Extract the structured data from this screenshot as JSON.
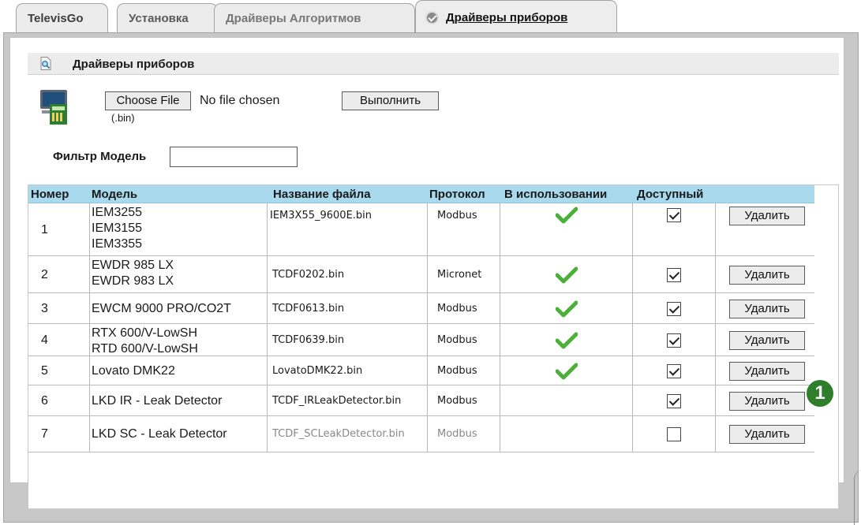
{
  "tabs": [
    {
      "label": "TelevisGo"
    },
    {
      "label": "Установка"
    },
    {
      "label": "Драйверы Алгоритмов"
    },
    {
      "label": "Драйверы приборов",
      "active": true
    }
  ],
  "section": {
    "title": "Драйверы приборов",
    "icon": "document-search-icon"
  },
  "upload": {
    "choose_file_label": "Choose File",
    "no_file_text": "No file chosen",
    "extension_note": "(.bin)",
    "execute_label": "Выполнить"
  },
  "filter": {
    "label": "Фильтр Модель",
    "value": ""
  },
  "table": {
    "headers": {
      "number": "Номер",
      "model": "Модель",
      "filename": "Название файла",
      "protocol": "Протокол",
      "in_use": "В использовании",
      "available": "Доступный"
    },
    "rows": [
      {
        "number": "1",
        "model": [
          "IEM3255",
          "IEM3155",
          "IEM3355"
        ],
        "filename": "IEM3X55_9600E.bin",
        "protocol": "Modbus",
        "in_use": true,
        "available": true,
        "delete_label": "Удалить"
      },
      {
        "number": "2",
        "model": [
          "EWDR 985 LX",
          "EWDR 983 LX"
        ],
        "filename": "TCDF0202.bin",
        "protocol": "Micronet",
        "in_use": true,
        "available": true,
        "delete_label": "Удалить"
      },
      {
        "number": "3",
        "model": [
          "EWCM 9000 PRO/CO2T"
        ],
        "filename": "TCDF0613.bin",
        "protocol": "Modbus",
        "in_use": true,
        "available": true,
        "delete_label": "Удалить"
      },
      {
        "number": "4",
        "model": [
          "RTX 600/V-LowSH",
          "RTD 600/V-LowSH"
        ],
        "filename": "TCDF0639.bin",
        "protocol": "Modbus",
        "in_use": true,
        "available": true,
        "delete_label": "Удалить"
      },
      {
        "number": "5",
        "model": [
          "Lovato DMK22"
        ],
        "filename": "LovatoDMK22.bin",
        "protocol": "Modbus",
        "in_use": true,
        "available": true,
        "delete_label": "Удалить"
      },
      {
        "number": "6",
        "model": [
          "LKD IR - Leak Detector"
        ],
        "filename": "TCDF_IRLeakDetector.bin",
        "protocol": "Modbus",
        "in_use": false,
        "available": true,
        "delete_label": "Удалить"
      },
      {
        "number": "7",
        "model": [
          "LKD SC - Leak Detector"
        ],
        "filename": "TCDF_SCLeakDetector.bin",
        "protocol": "Modbus",
        "in_use": false,
        "available": false,
        "delete_label": "Удалить",
        "disabled": true
      }
    ]
  },
  "callout": {
    "label": "1"
  },
  "colors": {
    "header_bg": "#a9d9ed",
    "check_green": "#4caf3a",
    "callout_green": "#2f7e2c"
  }
}
